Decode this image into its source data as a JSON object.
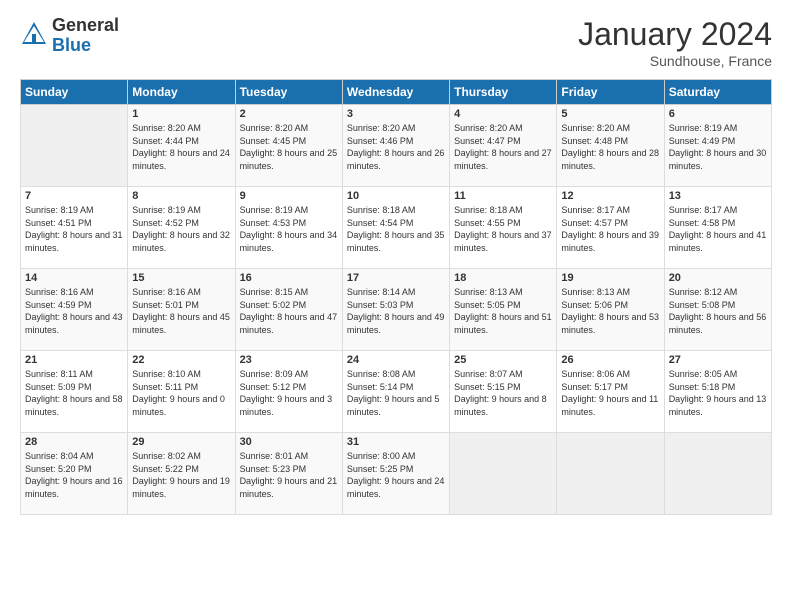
{
  "logo": {
    "general": "General",
    "blue": "Blue"
  },
  "title": "January 2024",
  "location": "Sundhouse, France",
  "days_header": [
    "Sunday",
    "Monday",
    "Tuesday",
    "Wednesday",
    "Thursday",
    "Friday",
    "Saturday"
  ],
  "weeks": [
    [
      {
        "day": "",
        "empty": true
      },
      {
        "day": "1",
        "sunrise": "Sunrise: 8:20 AM",
        "sunset": "Sunset: 4:44 PM",
        "daylight": "Daylight: 8 hours and 24 minutes."
      },
      {
        "day": "2",
        "sunrise": "Sunrise: 8:20 AM",
        "sunset": "Sunset: 4:45 PM",
        "daylight": "Daylight: 8 hours and 25 minutes."
      },
      {
        "day": "3",
        "sunrise": "Sunrise: 8:20 AM",
        "sunset": "Sunset: 4:46 PM",
        "daylight": "Daylight: 8 hours and 26 minutes."
      },
      {
        "day": "4",
        "sunrise": "Sunrise: 8:20 AM",
        "sunset": "Sunset: 4:47 PM",
        "daylight": "Daylight: 8 hours and 27 minutes."
      },
      {
        "day": "5",
        "sunrise": "Sunrise: 8:20 AM",
        "sunset": "Sunset: 4:48 PM",
        "daylight": "Daylight: 8 hours and 28 minutes."
      },
      {
        "day": "6",
        "sunrise": "Sunrise: 8:19 AM",
        "sunset": "Sunset: 4:49 PM",
        "daylight": "Daylight: 8 hours and 30 minutes."
      }
    ],
    [
      {
        "day": "7",
        "sunrise": "Sunrise: 8:19 AM",
        "sunset": "Sunset: 4:51 PM",
        "daylight": "Daylight: 8 hours and 31 minutes."
      },
      {
        "day": "8",
        "sunrise": "Sunrise: 8:19 AM",
        "sunset": "Sunset: 4:52 PM",
        "daylight": "Daylight: 8 hours and 32 minutes."
      },
      {
        "day": "9",
        "sunrise": "Sunrise: 8:19 AM",
        "sunset": "Sunset: 4:53 PM",
        "daylight": "Daylight: 8 hours and 34 minutes."
      },
      {
        "day": "10",
        "sunrise": "Sunrise: 8:18 AM",
        "sunset": "Sunset: 4:54 PM",
        "daylight": "Daylight: 8 hours and 35 minutes."
      },
      {
        "day": "11",
        "sunrise": "Sunrise: 8:18 AM",
        "sunset": "Sunset: 4:55 PM",
        "daylight": "Daylight: 8 hours and 37 minutes."
      },
      {
        "day": "12",
        "sunrise": "Sunrise: 8:17 AM",
        "sunset": "Sunset: 4:57 PM",
        "daylight": "Daylight: 8 hours and 39 minutes."
      },
      {
        "day": "13",
        "sunrise": "Sunrise: 8:17 AM",
        "sunset": "Sunset: 4:58 PM",
        "daylight": "Daylight: 8 hours and 41 minutes."
      }
    ],
    [
      {
        "day": "14",
        "sunrise": "Sunrise: 8:16 AM",
        "sunset": "Sunset: 4:59 PM",
        "daylight": "Daylight: 8 hours and 43 minutes."
      },
      {
        "day": "15",
        "sunrise": "Sunrise: 8:16 AM",
        "sunset": "Sunset: 5:01 PM",
        "daylight": "Daylight: 8 hours and 45 minutes."
      },
      {
        "day": "16",
        "sunrise": "Sunrise: 8:15 AM",
        "sunset": "Sunset: 5:02 PM",
        "daylight": "Daylight: 8 hours and 47 minutes."
      },
      {
        "day": "17",
        "sunrise": "Sunrise: 8:14 AM",
        "sunset": "Sunset: 5:03 PM",
        "daylight": "Daylight: 8 hours and 49 minutes."
      },
      {
        "day": "18",
        "sunrise": "Sunrise: 8:13 AM",
        "sunset": "Sunset: 5:05 PM",
        "daylight": "Daylight: 8 hours and 51 minutes."
      },
      {
        "day": "19",
        "sunrise": "Sunrise: 8:13 AM",
        "sunset": "Sunset: 5:06 PM",
        "daylight": "Daylight: 8 hours and 53 minutes."
      },
      {
        "day": "20",
        "sunrise": "Sunrise: 8:12 AM",
        "sunset": "Sunset: 5:08 PM",
        "daylight": "Daylight: 8 hours and 56 minutes."
      }
    ],
    [
      {
        "day": "21",
        "sunrise": "Sunrise: 8:11 AM",
        "sunset": "Sunset: 5:09 PM",
        "daylight": "Daylight: 8 hours and 58 minutes."
      },
      {
        "day": "22",
        "sunrise": "Sunrise: 8:10 AM",
        "sunset": "Sunset: 5:11 PM",
        "daylight": "Daylight: 9 hours and 0 minutes."
      },
      {
        "day": "23",
        "sunrise": "Sunrise: 8:09 AM",
        "sunset": "Sunset: 5:12 PM",
        "daylight": "Daylight: 9 hours and 3 minutes."
      },
      {
        "day": "24",
        "sunrise": "Sunrise: 8:08 AM",
        "sunset": "Sunset: 5:14 PM",
        "daylight": "Daylight: 9 hours and 5 minutes."
      },
      {
        "day": "25",
        "sunrise": "Sunrise: 8:07 AM",
        "sunset": "Sunset: 5:15 PM",
        "daylight": "Daylight: 9 hours and 8 minutes."
      },
      {
        "day": "26",
        "sunrise": "Sunrise: 8:06 AM",
        "sunset": "Sunset: 5:17 PM",
        "daylight": "Daylight: 9 hours and 11 minutes."
      },
      {
        "day": "27",
        "sunrise": "Sunrise: 8:05 AM",
        "sunset": "Sunset: 5:18 PM",
        "daylight": "Daylight: 9 hours and 13 minutes."
      }
    ],
    [
      {
        "day": "28",
        "sunrise": "Sunrise: 8:04 AM",
        "sunset": "Sunset: 5:20 PM",
        "daylight": "Daylight: 9 hours and 16 minutes."
      },
      {
        "day": "29",
        "sunrise": "Sunrise: 8:02 AM",
        "sunset": "Sunset: 5:22 PM",
        "daylight": "Daylight: 9 hours and 19 minutes."
      },
      {
        "day": "30",
        "sunrise": "Sunrise: 8:01 AM",
        "sunset": "Sunset: 5:23 PM",
        "daylight": "Daylight: 9 hours and 21 minutes."
      },
      {
        "day": "31",
        "sunrise": "Sunrise: 8:00 AM",
        "sunset": "Sunset: 5:25 PM",
        "daylight": "Daylight: 9 hours and 24 minutes."
      },
      {
        "day": "",
        "empty": true
      },
      {
        "day": "",
        "empty": true
      },
      {
        "day": "",
        "empty": true
      }
    ]
  ]
}
